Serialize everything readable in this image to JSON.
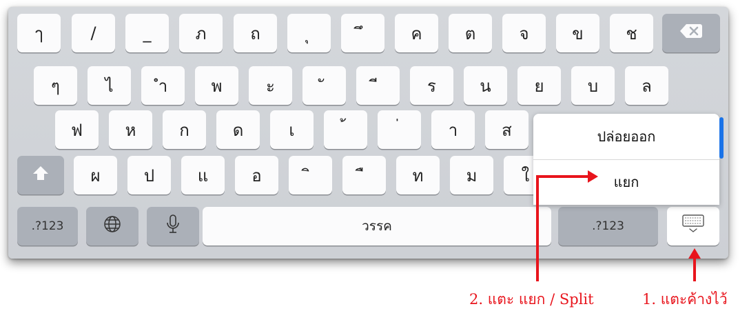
{
  "keyboard": {
    "row1": [
      "ๅ",
      "/",
      "_",
      "ภ",
      "ถ",
      "ุ",
      "ึ",
      "ค",
      "ต",
      "จ",
      "ข",
      "ช"
    ],
    "row2": [
      "ๆ",
      "ไ",
      "ำ",
      "พ",
      "ะ",
      "ั",
      "ี",
      "ร",
      "น",
      "ย",
      "บ",
      "ล"
    ],
    "row3": [
      "ฟ",
      "ห",
      "ก",
      "ด",
      "เ",
      "้",
      "่",
      "า",
      "ส"
    ],
    "row4": [
      "ผ",
      "ป",
      "แ",
      "อ",
      "ิ",
      "ื",
      "ท",
      "ม",
      "ใ"
    ],
    "numbers_left": ".?123",
    "numbers_right": ".?123",
    "space_label": "วรรค",
    "icons": {
      "backspace": "backspace-icon",
      "shift": "shift-arrow-icon",
      "globe": "globe-icon",
      "microphone": "microphone-icon",
      "keyboard": "keyboard-dismiss-icon"
    }
  },
  "popup": {
    "undock": "ปล่อยออก",
    "split": "แยก"
  },
  "annotations": {
    "step1": "1. แตะค้างไว้",
    "step2": "2. แตะ แยก / Split"
  },
  "colors": {
    "annotation": "#e8141c",
    "accent": "#1a73e8"
  }
}
